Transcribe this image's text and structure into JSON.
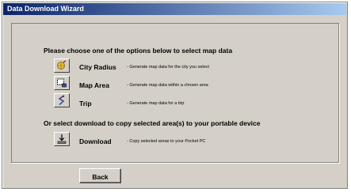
{
  "window": {
    "title": "Data Download Wizard"
  },
  "main": {
    "heading": "Please choose one of the options below to select map data",
    "options": [
      {
        "icon": "globe-pin-icon",
        "label": "City Radius",
        "description": "- Generate map data for the city you select"
      },
      {
        "icon": "map-area-icon",
        "label": "Map Area",
        "description": "- Generate map data within a chosen area"
      },
      {
        "icon": "route-icon",
        "label": "Trip",
        "description": "- Generate map data for a trip"
      }
    ],
    "download_heading": "Or select download to copy selected area(s) to your portable device",
    "download": {
      "icon": "download-icon",
      "label": "Download",
      "description": "- Copy selected areas to your Pocket PC"
    }
  },
  "footer": {
    "back_label": "Back"
  },
  "colors": {
    "titlebar_start": "#0a246a",
    "titlebar_end": "#a6caf0",
    "face": "#d4d0c8"
  }
}
